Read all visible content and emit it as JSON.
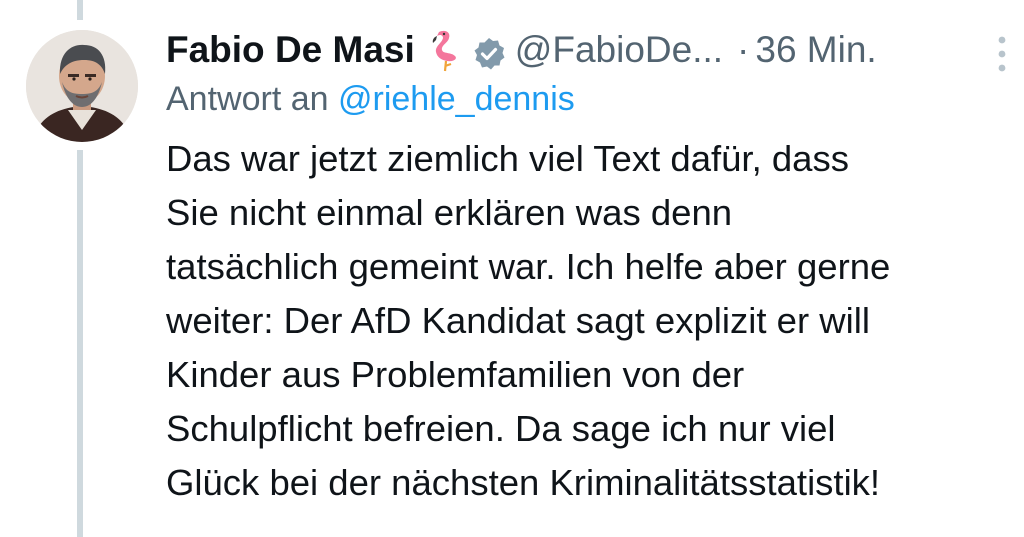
{
  "tweet": {
    "display_name": "Fabio De Masi",
    "handle": "@FabioDe...",
    "separator": "·",
    "timestamp": "36 Min.",
    "reply_prefix": "Antwort an",
    "reply_to": "@riehle_dennis",
    "body_lines": [
      "Das war jetzt ziemlich viel Text dafür, dass",
      "Sie nicht einmal erklären was denn",
      "tatsächlich gemeint war. Ich helfe aber gerne",
      "weiter: Der AfD Kandidat sagt explizit er will",
      "Kinder aus Problemfamilien von der",
      "Schulpflicht befreien. Da sage ich nur viel",
      "Glück bei der nächsten Kriminalitätsstatistik!"
    ]
  },
  "icons": {
    "avatar": "profile-photo",
    "name_emoji": "flamingo-icon",
    "verification": "verified-badge-icon",
    "menu": "more-options-icon"
  },
  "colors": {
    "text_primary": "#0f1419",
    "text_secondary": "#536471",
    "link": "#1d9bf0",
    "thread_line": "#cfd9de",
    "verified_badge": "#829aab"
  }
}
